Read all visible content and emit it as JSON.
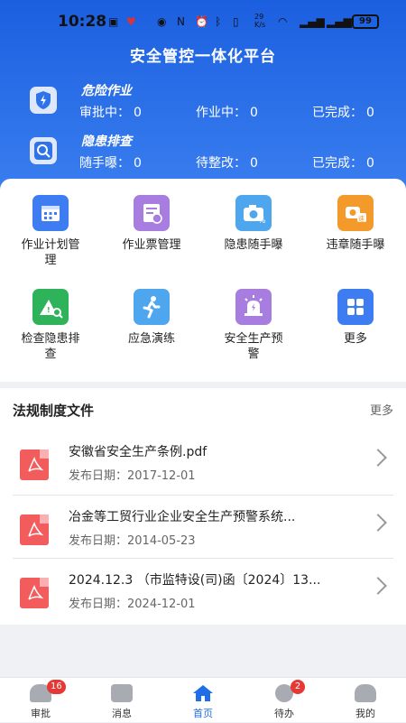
{
  "status_bar": {
    "time": "10:28",
    "battery": "99",
    "net_speed": "29 K/s"
  },
  "app_title": "安全管控一体化平台",
  "sections": [
    {
      "label": "危险作业",
      "stats": [
        {
          "label": "审批中：",
          "value": "0"
        },
        {
          "label": "作业中：",
          "value": "0"
        },
        {
          "label": "已完成：",
          "value": "0"
        }
      ]
    },
    {
      "label": "隐患排查",
      "stats": [
        {
          "label": "随手曝：",
          "value": "0"
        },
        {
          "label": "待整改：",
          "value": "0"
        },
        {
          "label": "已完成：",
          "value": "0"
        }
      ]
    }
  ],
  "grid": [
    {
      "label": "作业计划管理",
      "icon": "calendar-icon",
      "color": "#3d7cf1"
    },
    {
      "label": "作业票管理",
      "icon": "ticket-icon",
      "color": "#a77de0"
    },
    {
      "label": "隐患随手曝",
      "icon": "camera-icon",
      "color": "#4ea6ef"
    },
    {
      "label": "违章随手曝",
      "icon": "camera-speed-icon",
      "color": "#f39a2a"
    },
    {
      "label": "检查隐患排查",
      "icon": "mountain-search-icon",
      "color": "#2fb35a"
    },
    {
      "label": "应急演练",
      "icon": "running-icon",
      "color": "#4ea6ef"
    },
    {
      "label": "安全生产预警",
      "icon": "alarm-light-icon",
      "color": "#a77de0"
    },
    {
      "label": "更多",
      "icon": "grid-icon",
      "color": "#3d7cf1"
    }
  ],
  "docs": {
    "title": "法规制度文件",
    "more": "更多",
    "items": [
      {
        "name": "安徽省安全生产条例.pdf",
        "date": "发布日期：2017-12-01"
      },
      {
        "name": "冶金等工贸行业企业安全生产预警系统...",
        "date": "发布日期：2014-05-23"
      },
      {
        "name": "2024.12.3 （市监特设(司)函〔2024〕13...",
        "date": "发布日期：2024-12-01"
      }
    ]
  },
  "tabs": [
    {
      "label": "审批",
      "badge": "16",
      "icon": "approval-icon"
    },
    {
      "label": "消息",
      "badge": "",
      "icon": "message-icon"
    },
    {
      "label": "首页",
      "badge": "",
      "icon": "home-icon",
      "active": true
    },
    {
      "label": "待办",
      "badge": "2",
      "icon": "todo-icon"
    },
    {
      "label": "我的",
      "badge": "",
      "icon": "profile-icon"
    }
  ],
  "colors": {
    "primary": "#1b5fe0",
    "active_tab": "#1f6ee8",
    "badge": "#e53935"
  }
}
